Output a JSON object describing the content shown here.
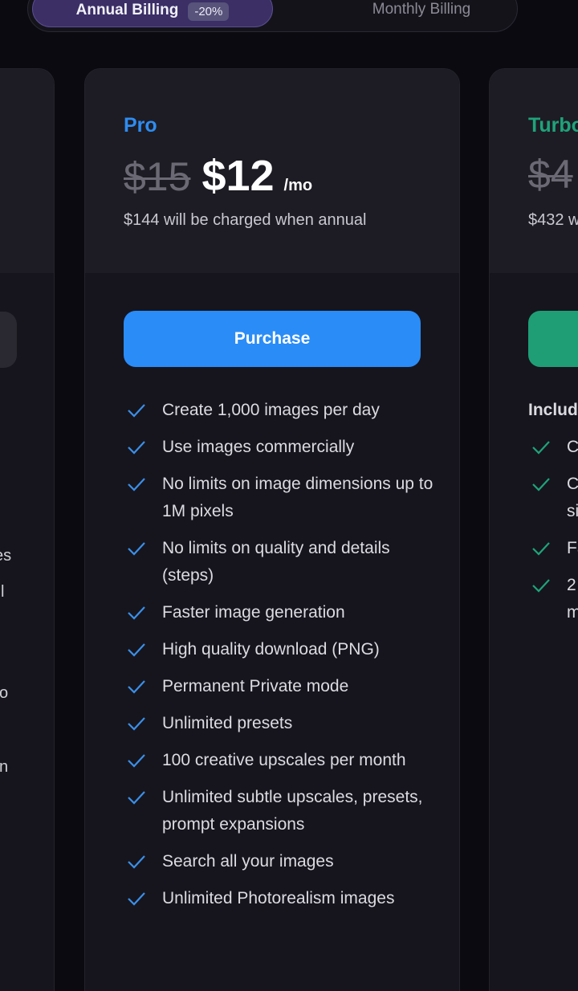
{
  "billing_toggle": {
    "annual_label": "Annual Billing",
    "discount_badge": "-20%",
    "monthly_label": "Monthly Billing"
  },
  "left_card": {
    "fragments": [
      "es",
      "l",
      "o",
      "n"
    ]
  },
  "pro": {
    "tier": "Pro",
    "tier_color": "#2e8cf0",
    "old_price": "$15",
    "price": "$12",
    "per": "/mo",
    "annual_note": "$144 will be charged when annual",
    "purchase_label": "Purchase",
    "button_color": "#2a8cf7",
    "check_color": "#3b8fe8",
    "features": [
      "Create 1,000 images per day",
      "Use images commercially",
      "No limits on image dimensions up to 1M pixels",
      "No limits on quality and details (steps)",
      "Faster image generation",
      "High quality download (PNG)",
      "Permanent Private mode",
      "Unlimited presets",
      "100 creative upscales per month",
      "Unlimited subtle upscales, presets, prompt expansions",
      "Search all your images",
      "Unlimited Photorealism images"
    ]
  },
  "turbo": {
    "tier": "Turbo",
    "tier_color": "#1fa37a",
    "old_price": "$4",
    "annual_note": "$432 w",
    "button_color": "#1f9e76",
    "check_color": "#1fa37a",
    "includes": "Includ",
    "features": [
      "C",
      "C si",
      "Fa",
      "2 m"
    ]
  }
}
